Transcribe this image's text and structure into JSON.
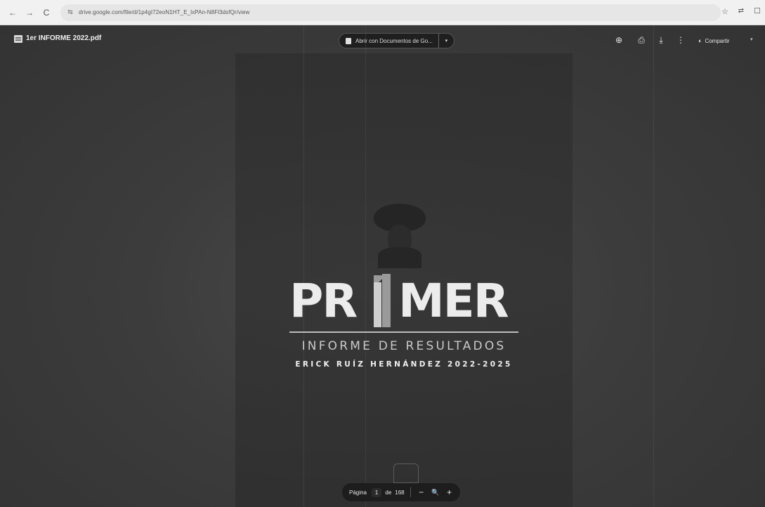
{
  "browser": {
    "url": "drive.google.com/file/d/1p4gI72eoN1HT_E_lxPAn-N8Fl3dsfQr/view",
    "back_glyph": "←",
    "forward_glyph": "→",
    "reload_glyph": "C",
    "site_icon_glyph": "⇆",
    "star_glyph": "☆",
    "extension_glyph": "⇄",
    "window_glyph": "☐"
  },
  "viewer": {
    "file_name": "1er INFORME 2022.pdf",
    "open_with_label": "Abrir con Documentos de Go...",
    "open_with_caret": "▾",
    "add_comment_glyph": "⊕",
    "print_glyph": "⎙",
    "download_glyph": "⤓",
    "more_glyph": "⋮",
    "share_label": "Compartir",
    "share_icon_glyph": "◐",
    "share_caret": "▾"
  },
  "document": {
    "title_left": "PR",
    "title_right": "MER",
    "subtitle": "INFORME DE RESULTADOS",
    "author": "ERICK RUÍZ HERNÁNDEZ 2022-2025"
  },
  "page_controls": {
    "label": "Página",
    "current": "1",
    "of": "de",
    "total": "168",
    "zoom_out_glyph": "−",
    "zoom_icon_glyph": "🔍",
    "zoom_in_glyph": "+"
  },
  "colors": {
    "viewer_bg": "#3a3a3a",
    "title_text": "#ececec",
    "control_bg": "#1d1d1d"
  }
}
